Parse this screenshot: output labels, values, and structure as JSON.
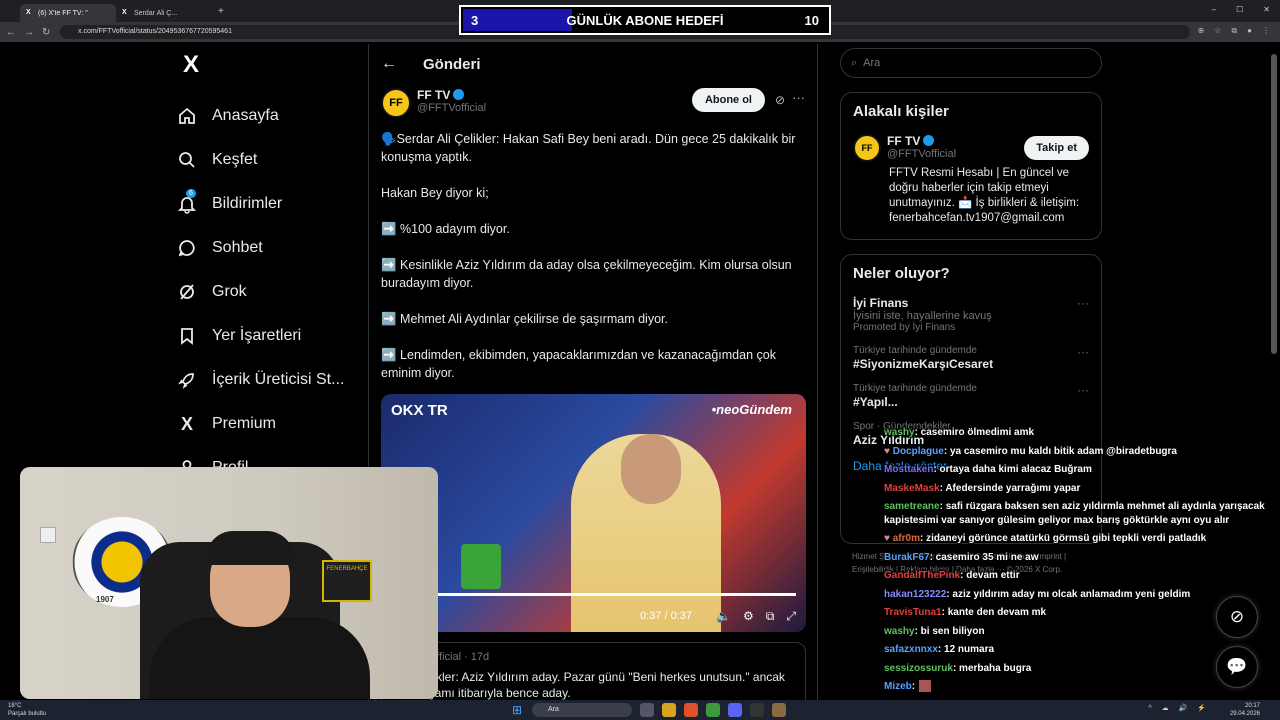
{
  "browser": {
    "tabs": [
      {
        "label": "(6) X'te FF TV: \""
      },
      {
        "label": "Serdar Ali Ç..."
      }
    ],
    "new_tab": "+",
    "url": "x.com/FFTVofficial/status/2049536767720595461"
  },
  "goal": {
    "current": "3",
    "title": "GÜNLÜK ABONE HEDEFİ",
    "target": "10",
    "fill_fraction": 0.3,
    "fill_color": "#1a14a8"
  },
  "nav": {
    "logo": "X",
    "items": [
      {
        "label": "Anasayfa",
        "icon": "home-icon"
      },
      {
        "label": "Keşfet",
        "icon": "search-icon"
      },
      {
        "label": "Bildirimler",
        "icon": "bell-icon",
        "badge": "6"
      },
      {
        "label": "Sohbet",
        "icon": "chat-icon"
      },
      {
        "label": "Grok",
        "icon": "grok-icon"
      },
      {
        "label": "Yer İşaretleri",
        "icon": "bookmark-icon"
      },
      {
        "label": "İçerik Üreticisi St...",
        "icon": "rocket-icon"
      },
      {
        "label": "Premium",
        "icon": "x-icon"
      },
      {
        "label": "Profil",
        "icon": "profile-icon"
      }
    ]
  },
  "post": {
    "header": "Gönderi",
    "author_name": "FF TV",
    "author_handle": "@FFTVofficial",
    "avatar_text": "FF",
    "subscribe_label": "Abone ol",
    "paragraphs": [
      "🗣️Serdar Ali Çelikler: Hakan Safi Bey beni aradı. Dün gece 25 dakikalık bir konuşma yaptık.",
      "Hakan Bey diyor ki;",
      "➡️ %100 adayım diyor.",
      "➡️ Kesinlikle Aziz Yıldırım da aday olsa çekilmeyeceğim. Kim olursa olsun buradayım diyor.",
      "➡️ Mehmet Ali Aydınlar çekilirse de şaşırmam diyor.",
      "➡️ Lendimden, ekibimden, yapacaklarımızdan ve kazanacağımdan çok eminim diyor."
    ],
    "video": {
      "logo_left": "OKX TR",
      "logo_right": "•neoGündem",
      "time": "0:37 / 0:37",
      "progress_fraction": 1.0
    },
    "quote": {
      "meta": "@FFTVofficial · 17d",
      "text": "r Ali Çelikler: Aziz Yıldırım aday. Pazar günü \"Beni herkes unutsun.\" ancak Salı akşamı itibarıyla bence aday."
    }
  },
  "right": {
    "search_placeholder": "Ara",
    "related": {
      "title": "Alakalı kişiler",
      "name": "FF TV",
      "handle": "@FFTVofficial",
      "follow_label": "Takip et",
      "bio": "FFTV Resmi Hesabı | En güncel ve doğru haberler için takip etmeyi unutmayınız. 📩 İş birlikleri & iletişim: fenerbahcefan.tv1907@gmail.com"
    },
    "trends": {
      "title": "Neler oluyor?",
      "items": [
        {
          "meta": "",
          "title": "İyi Finans",
          "sub": "İyisini iste, hayallerine kavuş",
          "sub2": "Promoted by İyi Finans"
        },
        {
          "meta": "Türkiye tarihinde gündemde",
          "title": "#SiyonizmeKarşıCesaret",
          "sub": "",
          "sub2": ""
        },
        {
          "meta": "Türkiye tarihinde gündemde",
          "title": "#Yapıl...",
          "sub": "",
          "sub2": ""
        },
        {
          "meta": "Spor · Gündemdekiler",
          "title": "Aziz Yıldırım",
          "sub": "",
          "sub2": ""
        }
      ],
      "show_more": "Daha fazla göster"
    },
    "footer": "Hizmet Şartları | Gizlilik Politikası | Çerez Politikası | Imprint | Erişilebilirlik | Reklam bilgisi | Daha fazla ··· © 2026 X Corp."
  },
  "chat": [
    {
      "user": "washy",
      "color": "#60c060",
      "text": ": casemiro ölmedimi amk"
    },
    {
      "user": "Docplague",
      "color": "#5aa0ff",
      "text": ": ya casemiro mu kaldı bitik adam @biradetbugra"
    },
    {
      "user": "Mosttaken",
      "color": "#7a6cff",
      "text": ": ortaya daha kimi alacaz Buğram"
    },
    {
      "user": "MaskeMask",
      "color": "#e04040",
      "text": ": Afedersinde yarrağımı yapar"
    },
    {
      "user": "sametreane",
      "color": "#60c060",
      "text": ": safi rüzgara baksen sen aziz yıldırmla mehmet ali aydınla yarışacak kapistesimi var sanıyor gülesim geliyor max barış göktürkle aynı oyu alır"
    },
    {
      "user": "afr0m",
      "color": "#e06a3a",
      "text": ": zidaneyi görünce atatürkü görmsü gibi tepkli verdi patladık"
    },
    {
      "user": "BurakF67",
      "color": "#5aa0ff",
      "text": ": casemiro 35 mi ne aw"
    },
    {
      "user": "GandalfThePink",
      "color": "#e04040",
      "text": ": devam ettir"
    },
    {
      "user": "hakan123222",
      "color": "#8a8aff",
      "text": ": aziz yıldırım aday mı olcak anlamadım yeni geldim"
    },
    {
      "user": "TravisTuna1",
      "color": "#e04040",
      "text": ": kante den devam mk"
    },
    {
      "user": "washy",
      "color": "#60c060",
      "text": ": bi sen biliyon"
    },
    {
      "user": "safazxnnxx",
      "color": "#5aa0ff",
      "text": ": 12 numara"
    },
    {
      "user": "sessizossuruk",
      "color": "#60c060",
      "text": ": merbaha bugra"
    },
    {
      "user": "Mizeb",
      "color": "#5aa0ff",
      "text": ":"
    }
  ],
  "webcam": {
    "scarf_text": "FENERBAHÇE",
    "logo_text": "1907"
  },
  "taskbar": {
    "weather_temp": "18°C",
    "weather_desc": "Parçalı bulutlu",
    "search": "Ara",
    "time": "20:17",
    "date": "29.04.2026"
  }
}
